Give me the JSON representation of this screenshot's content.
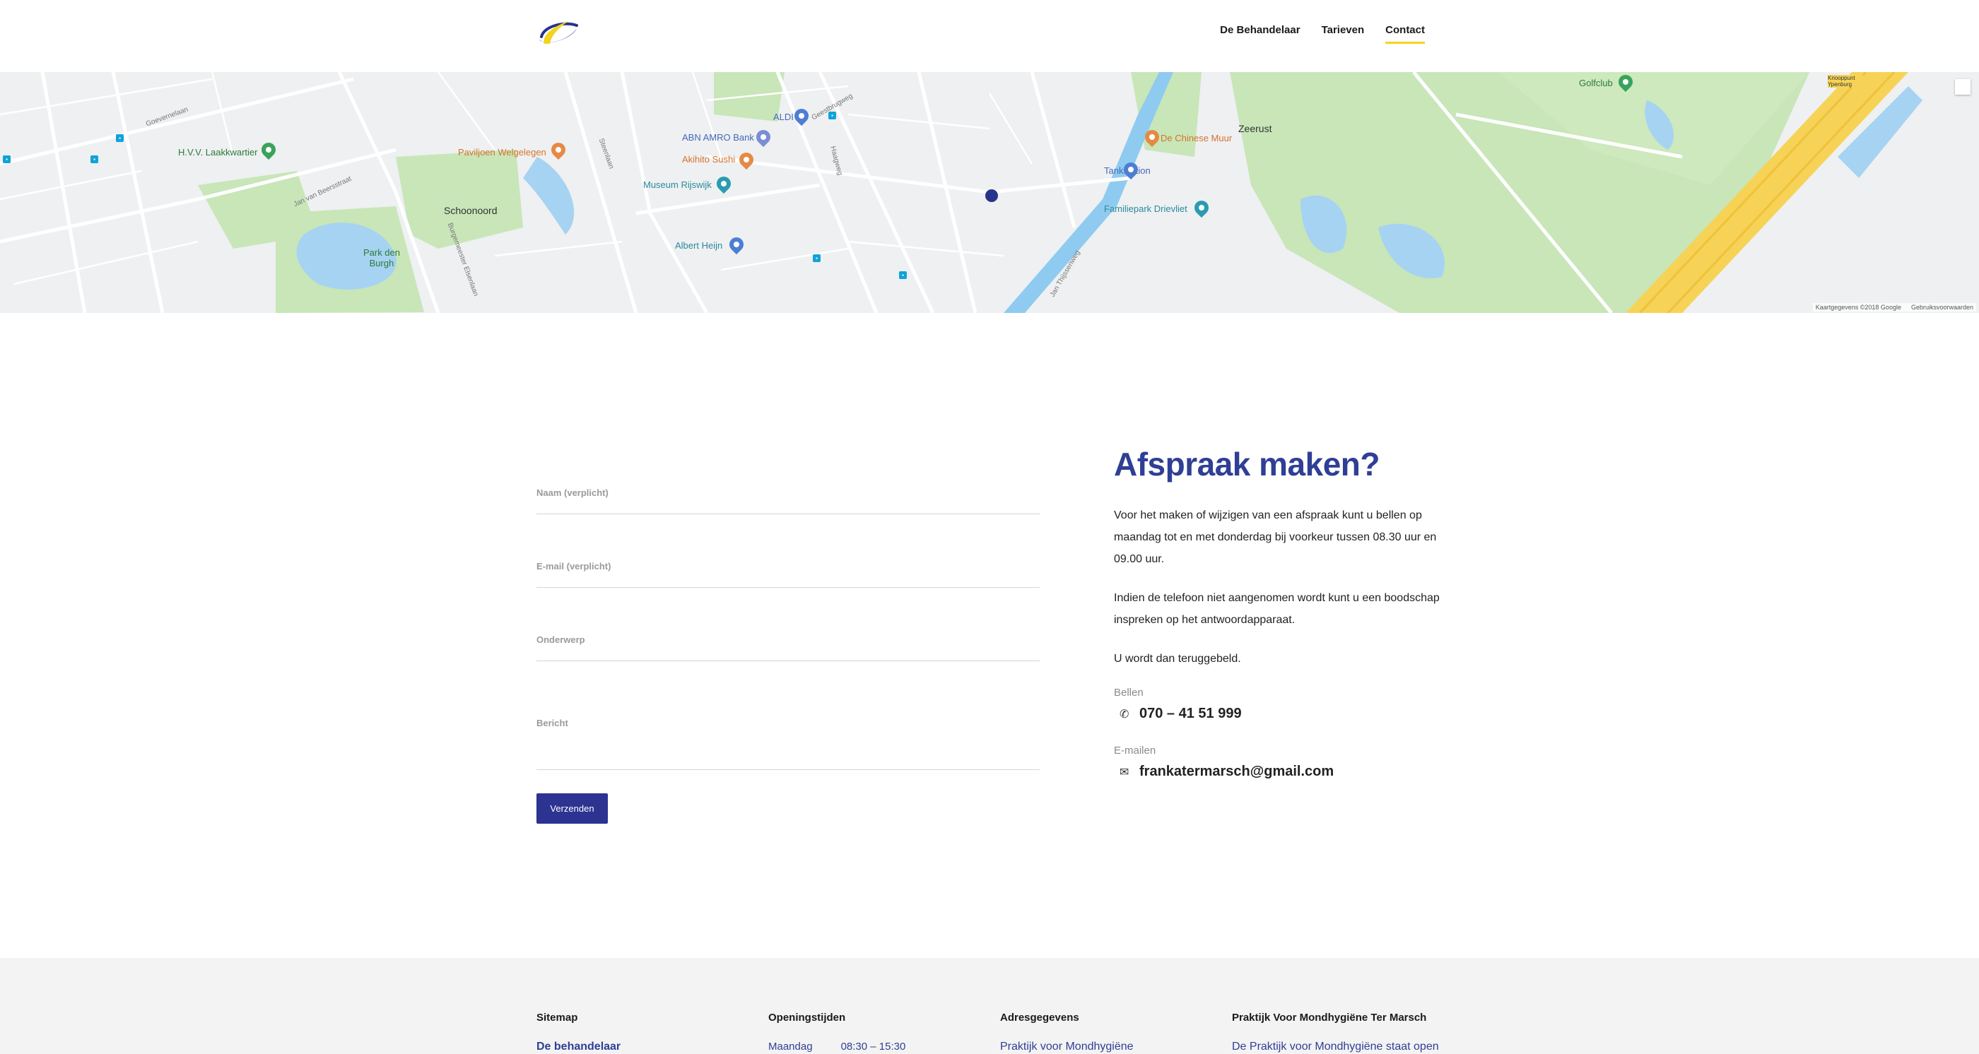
{
  "nav": {
    "items": [
      {
        "label": "De Behandelaar"
      },
      {
        "label": "Tarieven"
      },
      {
        "label": "Contact"
      }
    ],
    "active_index": 2
  },
  "map": {
    "labels": {
      "goevernelaan": "Goevernelaan",
      "laakkwartier": "H.V.V. Laakkwartier",
      "paviljoen": "Paviljoen Welgelegen",
      "schoonoord": "Schoonoord",
      "park_den_burgh": "Park den Burgh",
      "abn_amro": "ABN AMRO Bank",
      "akihito": "Akihito Sushi",
      "museum": "Museum Rijswijk",
      "albert_heijn": "Albert Heijn",
      "aldi": "ALDI",
      "chinese_muur": "De Chinese Muur",
      "tankstation": "Tankstation",
      "familiepark": "Familiepark Drievliet",
      "zeerust": "Zeerust",
      "golfclub": "Golfclub",
      "geestbrugweg": "Geestbrugweg",
      "steenlaan": "Steenlaan",
      "haagweg": "Haagweg",
      "jan_thijssenweg": "Jan Thijssenweg",
      "burgemeester": "Burgemeester Elsenlaan",
      "jan_van_beersstraat": "Jan van Beersstraat",
      "knooppunt": "Knooppunt Ypenburg"
    },
    "attribution": "Kaartgegevens ©2018 Google",
    "terms": "Gebruiksvoorwaarden"
  },
  "form": {
    "name_label": "Naam (verplicht)",
    "email_label": "E-mail (verplicht)",
    "subject_label": "Onderwerp",
    "message_label": "Bericht",
    "submit_label": "Verzenden"
  },
  "info": {
    "title": "Afspraak maken?",
    "paragraph1": "Voor het maken of wijzigen van een afspraak kunt u bellen op maandag tot en met donderdag bij voorkeur tussen 08.30 uur en 09.00 uur.",
    "paragraph2": "Indien de telefoon niet aangenomen wordt kunt u een boodschap inspreken op het antwoordapparaat.",
    "paragraph3": "U wordt dan teruggebeld.",
    "phone_label": "Bellen",
    "phone": "070 – 41 51 999",
    "email_label": "E-mailen",
    "email": "frankatermarsch@gmail.com"
  },
  "footer": {
    "sitemap": {
      "title": "Sitemap",
      "first_link": "De behandelaar"
    },
    "hours": {
      "title": "Openingstijden",
      "day": "Maandag",
      "time": "08:30 – 15:30"
    },
    "address": {
      "title": "Adresgegevens",
      "first_line": "Praktijk voor Mondhygiëne"
    },
    "about": {
      "title": "Praktijk Voor Mondhygiëne Ter Marsch",
      "first_line": "De Praktijk voor Mondhygiëne staat open"
    }
  },
  "colors": {
    "brand_blue": "#2f3f95",
    "button_blue": "#2c3391",
    "accent_yellow": "#f2d41f",
    "map_green": "#c8e6b8",
    "map_water": "#8fcbf0",
    "map_highway": "#f6d356"
  },
  "icons": {
    "phone": "phone-icon",
    "email": "envelope-icon"
  }
}
